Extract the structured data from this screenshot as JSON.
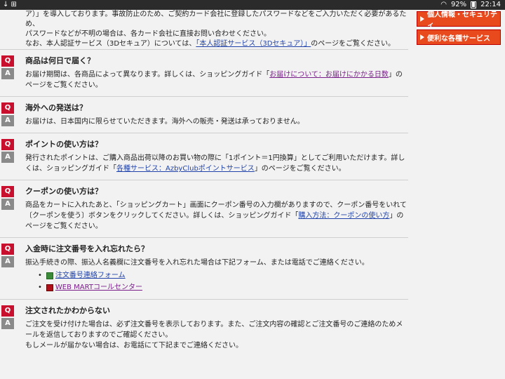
{
  "statusbar": {
    "left_icons": "↓ ⊞",
    "battery": "92%",
    "time": "22:14"
  },
  "intro": {
    "line1": "ア）」を導入しております。事故防止のため、ご契約カード会社に登録したパスワードなどをご入力いただく必要があるため、",
    "line2": "パスワードなどが不明の場合は、各カード会社に直接お問い合わせください。",
    "line3_pre": "なお、本人認証サービス（3Dセキュア）については、",
    "line3_link": "「本人認証サービス（3Dセキュア）」",
    "line3_post": "のページをご覧ください。"
  },
  "badges": {
    "q": "Q",
    "a": "A"
  },
  "qa": [
    {
      "q": "商品は何日で届く？",
      "a_pre": "お届け期間は、各商品によって異なります。詳しくは、ショッピングガイド「",
      "a_link": "お届けについて：お届けにかかる日数",
      "a_post": "」のページをご覧ください。"
    },
    {
      "q": "海外への発送は？",
      "a": "お届けは、日本国内に限らせていただきます。海外への販売・発送は承っておりません。"
    },
    {
      "q": "ポイントの使い方は？",
      "a_pre": "発行されたポイントは、ご購入商品出荷以降のお買い物の際に「1ポイント＝1円換算」としてご利用いただけます。詳しくは、ショッピングガイド「",
      "a_link": "各種サービス：AzbyClubポイントサービス",
      "a_post": "」のページをご覧ください。"
    },
    {
      "q": "クーポンの使い方は？",
      "a_pre": "商品をカートに入れたあと、「ショッピングカート」画面にクーポン番号の入力欄がありますので、クーポン番号をいれて〔クーポンを使う〕ボタンをクリックしてください。詳しくは、ショッピングガイド「",
      "a_link": "購入方法：クーポンの使い方",
      "a_post": "」のページをご覧ください。"
    },
    {
      "q": "入金時に注文番号を入れ忘れたら？",
      "a": "振込手続きの際、振込人名義欄に注文番号を入れ忘れた場合は下記フォーム、または電話でご連絡ください。",
      "links": [
        "注文番号連絡フォーム",
        "WEB MARTコールセンター"
      ]
    },
    {
      "q": "注文されたかわからない",
      "a": "ご注文を受け付けた場合は、必ず注文番号を表示しております。また、ご注文内容の確認とご注文番号のご連絡のためメールを返信しておりますのでご確認ください。",
      "a2": "もしメールが届かない場合は、お電話にて下記までご連絡ください。"
    }
  ],
  "sidebar": {
    "items": [
      "個人情報・セキュリティ",
      "便利な各種サービス"
    ]
  }
}
